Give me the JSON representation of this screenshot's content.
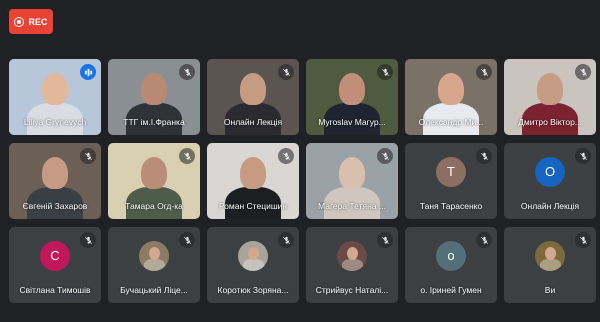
{
  "recording": {
    "label": "REC",
    "color": "#ea4335"
  },
  "participants": [
    {
      "name": "Liliya Grynevych",
      "mic": "speaking",
      "type": "video",
      "bg": "#b7c6d8",
      "skin": "#e2b79a",
      "cloth": "#d9dde3"
    },
    {
      "name": "ТТГ ім.І.Франка",
      "mic": "muted",
      "type": "video",
      "bg": "#8a8f93",
      "skin": "#b98a73",
      "cloth": "#2e3338"
    },
    {
      "name": "Онлайн Лекція",
      "mic": "muted",
      "type": "video",
      "bg": "#5a5550",
      "skin": "#c59b82",
      "cloth": "#2b2a2e"
    },
    {
      "name": "Myroslav Магур...",
      "mic": "muted",
      "type": "video",
      "bg": "#4f5a3e",
      "skin": "#c18f79",
      "cloth": "#1f2430"
    },
    {
      "name": "Олександр Ми...",
      "mic": "muted",
      "type": "video",
      "bg": "#7a7266",
      "skin": "#d7a68c",
      "cloth": "#e8eaf0"
    },
    {
      "name": "Дмитро Віктор...",
      "mic": "muted",
      "type": "video",
      "bg": "#c9c4bd",
      "skin": "#c69c86",
      "cloth": "#7b2330"
    },
    {
      "name": "Євгеній Захаров",
      "mic": "muted",
      "type": "video",
      "bg": "#6b5f56",
      "skin": "#c79a84",
      "cloth": "#3a3f46"
    },
    {
      "name": "Тамара Огд-ка",
      "mic": "muted",
      "type": "video",
      "bg": "#d8d0b0",
      "skin": "#b98d77",
      "cloth": "#4e5c4a"
    },
    {
      "name": "Роман Стецишин",
      "mic": "muted",
      "type": "video",
      "bg": "#d9d7d3",
      "skin": "#c79b82",
      "cloth": "#1c1e22"
    },
    {
      "name": "Магера Тетяна ...",
      "mic": "muted",
      "type": "video",
      "bg": "#9aa1a7",
      "skin": "#d8bfae",
      "cloth": "#cfc7bf"
    },
    {
      "name": "Таня Тарасенко",
      "mic": "muted",
      "type": "avatar",
      "initial": "Т",
      "color": "#8d6e63"
    },
    {
      "name": "Онлайн Лекція",
      "mic": "muted",
      "type": "avatar",
      "initial": "О",
      "color": "#1565c0"
    },
    {
      "name": "Світлана Тимошів",
      "mic": "muted",
      "type": "avatar",
      "initial": "С",
      "color": "#c2185b"
    },
    {
      "name": "Бучацький Ліце...",
      "mic": "muted",
      "type": "photo",
      "color": "#8b7b62"
    },
    {
      "name": "Коротюк Зоряна...",
      "mic": "muted",
      "type": "photo",
      "color": "#a7a49a"
    },
    {
      "name": "Стрийвус Наталі...",
      "mic": "muted",
      "type": "photo",
      "color": "#6a4a44"
    },
    {
      "name": "о. Іриней Гумен",
      "mic": "muted",
      "type": "avatar",
      "initial": "о",
      "color": "#546e7a"
    },
    {
      "name": "Ви",
      "mic": "muted",
      "type": "photo",
      "color": "#7d6a3c"
    }
  ]
}
